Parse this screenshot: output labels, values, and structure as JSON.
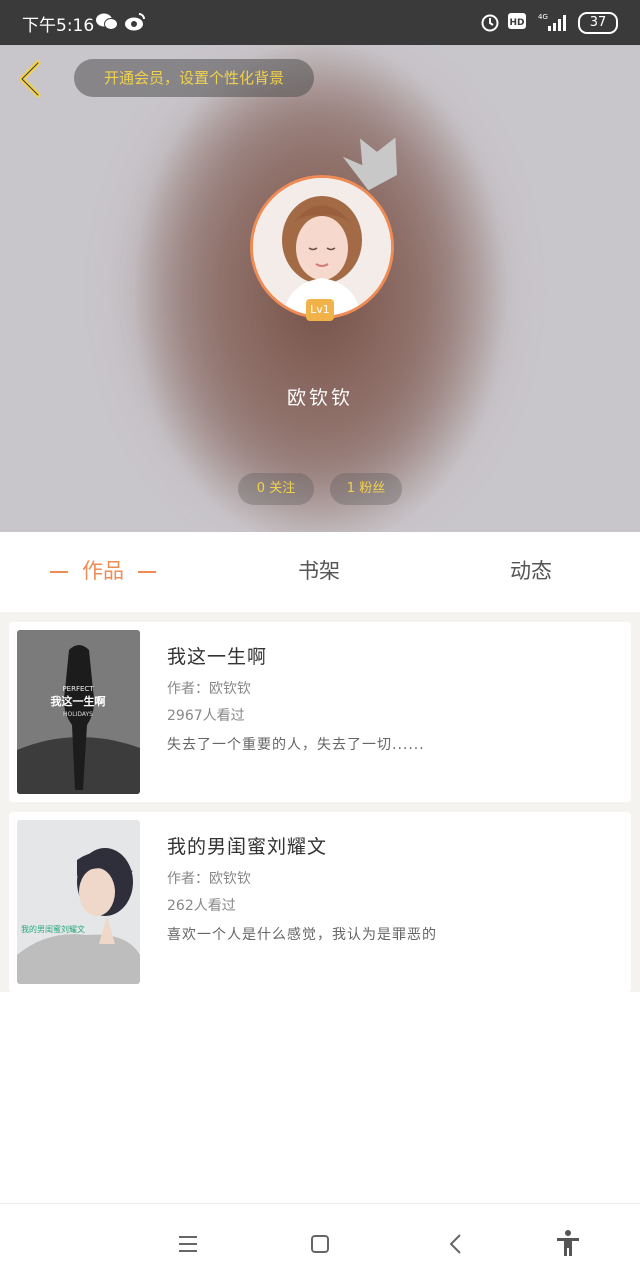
{
  "status_bar": {
    "time": "下午5:16",
    "battery": "37"
  },
  "header": {
    "vip_banner": "开通会员，设置个性化背景"
  },
  "profile": {
    "level_badge": "Lv1",
    "nickname": "欧钦钦",
    "following": "0 关注",
    "followers": "1 粉丝"
  },
  "tabs": [
    {
      "label": "作品",
      "active": true
    },
    {
      "label": "书架",
      "active": false
    },
    {
      "label": "动态",
      "active": false
    }
  ],
  "works": [
    {
      "title": "我这一生啊",
      "author": "作者：欧钦钦",
      "views": "2967人看过",
      "description": "失去了一个重要的人，失去了一切......",
      "cover_text_top": "PERFECT",
      "cover_text_main": "我这一生啊",
      "cover_text_bottom": "HOLIDAYS"
    },
    {
      "title": "我的男闺蜜刘耀文",
      "author": "作者：欧钦钦",
      "views": "262人看过",
      "description": "喜欢一个人是什么感觉，我认为是罪恶的",
      "cover_text_main": "我的男闺蜜刘耀文"
    }
  ],
  "colors": {
    "accent": "#ef8b55",
    "vip_text": "#f3d24b",
    "status_bar": "#3a3a3a"
  }
}
